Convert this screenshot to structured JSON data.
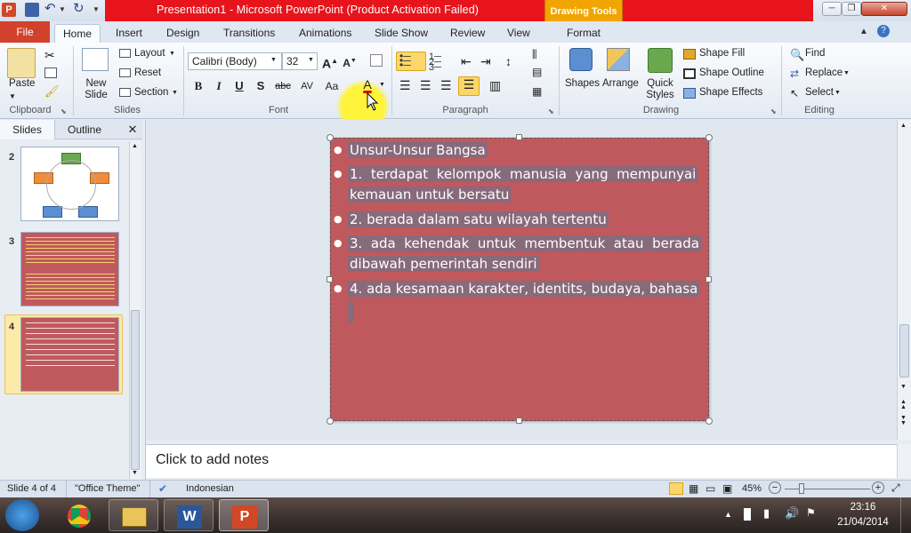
{
  "window": {
    "title": "Presentation1  -  Microsoft PowerPoint (Product Activation Failed)",
    "context_tab": "Drawing Tools",
    "controls": [
      "minimize",
      "restore",
      "close"
    ]
  },
  "tabs": [
    "File",
    "Home",
    "Insert",
    "Design",
    "Transitions",
    "Animations",
    "Slide Show",
    "Review",
    "View",
    "Format"
  ],
  "ribbon": {
    "clipboard": {
      "paste": "Paste",
      "group": "Clipboard"
    },
    "slides": {
      "new_slide": "New Slide",
      "layout": "Layout",
      "reset": "Reset",
      "section": "Section",
      "group": "Slides"
    },
    "font": {
      "name": "Calibri (Body)",
      "size": "32",
      "group": "Font",
      "bold": "B",
      "italic": "I",
      "underline": "U",
      "shadow": "S",
      "strike": "abc",
      "spacing": "AV",
      "case": "Aa",
      "color": "A"
    },
    "paragraph": {
      "group": "Paragraph"
    },
    "drawing": {
      "shapes": "Shapes",
      "arrange": "Arrange",
      "quick_styles": "Quick Styles",
      "fill": "Shape Fill",
      "outline": "Shape Outline",
      "effects": "Shape Effects",
      "group": "Drawing"
    },
    "editing": {
      "find": "Find",
      "replace": "Replace",
      "select": "Select",
      "group": "Editing"
    }
  },
  "left_panel": {
    "tabs": [
      "Slides",
      "Outline"
    ],
    "thumbnails": [
      {
        "number": "2"
      },
      {
        "number": "3"
      },
      {
        "number": "4"
      }
    ]
  },
  "slide": {
    "items": [
      {
        "lines": [
          "Unsur-Unsur Bangsa"
        ]
      },
      {
        "lines": [
          "1.  terdapat  kelompok  manusia  yang  mempunyai",
          "kemauan untuk bersatu"
        ]
      },
      {
        "lines": [
          "2. berada dalam satu wilayah tertentu"
        ]
      },
      {
        "lines": [
          "3.  ada  kehendak  untuk  membentuk  atau  berada",
          "dibawah pemerintah sendiri"
        ]
      },
      {
        "lines": [
          "4. ada kesamaan karakter, identits, budaya, bahasa"
        ]
      }
    ],
    "background": "#c0595d"
  },
  "notes": {
    "placeholder": "Click to add notes"
  },
  "status": {
    "slide": "Slide 4 of 4",
    "theme": "\"Office Theme\"",
    "language": "Indonesian",
    "zoom": "45%"
  },
  "taskbar": {
    "time": "23:16",
    "date": "21/04/2014"
  }
}
